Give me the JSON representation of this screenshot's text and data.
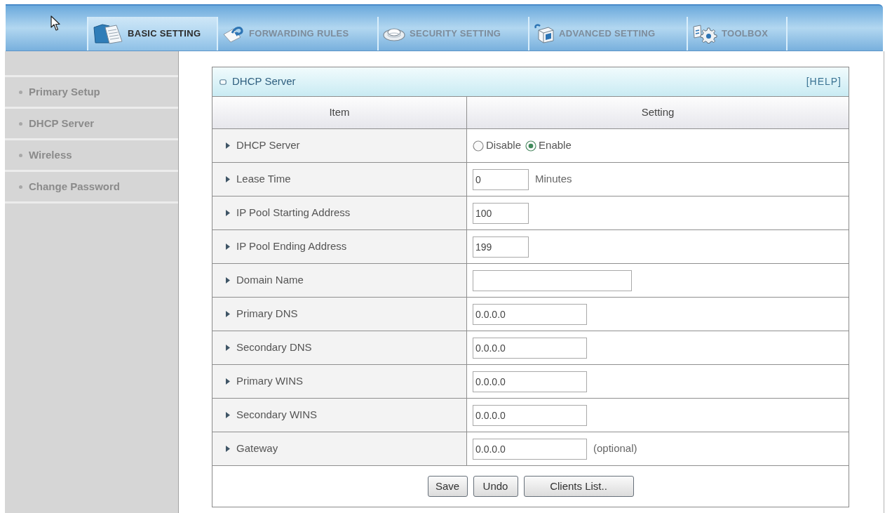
{
  "top_bar": {
    "tabs": [
      {
        "label": "BASIC SETTING",
        "selected": true
      },
      {
        "label": "FORWARDING RULES",
        "selected": false
      },
      {
        "label": "SECURITY SETTING",
        "selected": false
      },
      {
        "label": "ADVANCED SETTING",
        "selected": false
      },
      {
        "label": "TOOLBOX",
        "selected": false
      }
    ]
  },
  "sidebar": {
    "items": [
      {
        "label": "Primary Setup"
      },
      {
        "label": "DHCP Server"
      },
      {
        "label": "Wireless"
      },
      {
        "label": "Change Password"
      }
    ]
  },
  "panel": {
    "title": "DHCP Server",
    "help": "[HELP]",
    "columns": [
      "Item",
      "Setting"
    ],
    "rows": [
      {
        "label": "DHCP Server",
        "kind": "radio",
        "options": [
          {
            "label": "Disable",
            "selected": false
          },
          {
            "label": "Enable",
            "selected": true
          }
        ]
      },
      {
        "label": "Lease Time",
        "kind": "number",
        "value": "0",
        "suffix": "Minutes"
      },
      {
        "label": "IP Pool Starting Address",
        "kind": "number",
        "value": "100"
      },
      {
        "label": "IP Pool Ending Address",
        "kind": "number",
        "value": "199"
      },
      {
        "label": "Domain Name",
        "kind": "text"
      },
      {
        "label": "Primary DNS",
        "kind": "ip",
        "value": "0.0.0.0"
      },
      {
        "label": "Secondary DNS",
        "kind": "ip",
        "value": "0.0.0.0"
      },
      {
        "label": "Primary WINS",
        "kind": "ip",
        "value": "0.0.0.0"
      },
      {
        "label": "Secondary WINS",
        "kind": "ip",
        "value": "0.0.0.0"
      },
      {
        "label": "Gateway",
        "kind": "ip",
        "value": "0.0.0.0",
        "suffix": "(optional)"
      }
    ],
    "buttons": [
      "Save",
      "Undo",
      "Clients List.."
    ]
  }
}
